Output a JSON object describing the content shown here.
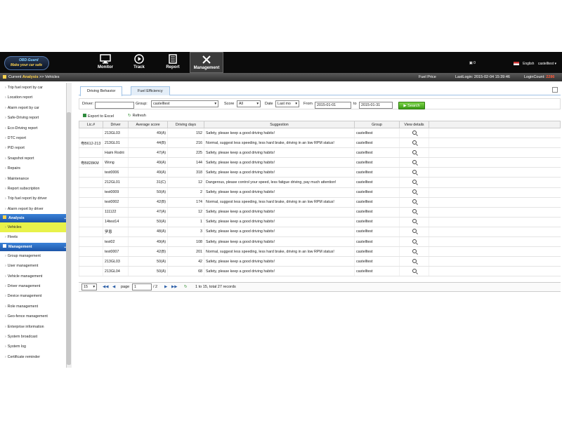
{
  "app": {
    "logo_top": "OBD-Guard",
    "logo_bottom": "Make your car safe"
  },
  "nav": [
    {
      "label": "Monitor",
      "icon": "monitor-icon"
    },
    {
      "label": "Track",
      "icon": "play-icon"
    },
    {
      "label": "Report",
      "icon": "report-icon"
    },
    {
      "label": "Management",
      "icon": "tools-icon"
    }
  ],
  "topright": {
    "camera_count": "0",
    "language": "English",
    "user": "castelltest"
  },
  "subbar": {
    "breadcrumb_prefix": "Current",
    "breadcrumb_section": "Analysis",
    "breadcrumb_sep": ">>",
    "breadcrumb_page": "Vehicles",
    "fuel_price": "Fuel Price",
    "last_login_label": "LastLogin:",
    "last_login_value": "2015-02-04 15:39:46",
    "login_count_label": "LoginCount:",
    "login_count_value": "2286"
  },
  "sidebar": {
    "report_items": [
      "Trip fuel report by car",
      "Location report",
      "Alarm report by car",
      "Safe-Driving report",
      "Eco-Driving report",
      "DTC report",
      "PID report",
      "Snapshot report",
      "Repairs",
      "Maintenance",
      "Report subscription",
      "Trip fuel report by driver",
      "Alarm report by driver"
    ],
    "analysis_head": "Analysis",
    "analysis_items": [
      "Vehicles",
      "Fleets"
    ],
    "management_head": "Management",
    "management_items": [
      "Group management",
      "User management",
      "Vehicle management",
      "Driver management",
      "Device management",
      "Role management",
      "Geo-fence management",
      "Enterprise information",
      "System broadcast",
      "System log",
      "Certificate reminder"
    ]
  },
  "tabs": [
    "Driving Behavior",
    "Fuel Efficiency"
  ],
  "filters": {
    "driver_label": "Driver:",
    "driver_value": "",
    "group_label": "Group:",
    "group_value": "castelltest",
    "score_label": "Score",
    "score_value": "All",
    "date_label": "Date",
    "date_value": "Last mo",
    "from_label": "From",
    "from_value": "2015-01-01",
    "to_label": "to",
    "to_value": "2015-01-31",
    "search_label": "Search"
  },
  "tools": {
    "export_label": "Export to Excel",
    "refresh_label": "Refresh"
  },
  "table": {
    "headers": [
      "Lic.#",
      "Driver",
      "Average score",
      "Driving days",
      "Suggestion",
      "Group",
      "View details"
    ],
    "rows": [
      [
        "",
        "213GL03",
        "49(A)",
        "152",
        "Safety, please keep a good driving habits!",
        "castelltest"
      ],
      [
        "粤B612-213",
        "213GL01",
        "44(B)",
        "216",
        "Normal, suggest less speeding, less hard brake, driving in an low RPM status!",
        "castelltest"
      ],
      [
        "",
        "Haim Rodrii",
        "47(A)",
        "225",
        "Safety, please keep a good driving habits!",
        "castelltest"
      ],
      [
        "粤B828KM",
        "Wong",
        "49(A)",
        "144",
        "Safety, please keep a good driving habits!",
        "castelltest"
      ],
      [
        "",
        "test0006",
        "49(A)",
        "318",
        "Safety, please keep a good driving habits!",
        "castelltest"
      ],
      [
        "",
        "212GL01",
        "31(C)",
        "12",
        "Dangerous, please control your speed, less fatigue driving, pay much attention!",
        "castelltest"
      ],
      [
        "",
        "test0009",
        "50(A)",
        "2",
        "Safety, please keep a good driving habits!",
        "castelltest"
      ],
      [
        "",
        "test0002",
        "42(B)",
        "174",
        "Normal, suggest less speeding, less hard brake, driving in an low RPM status!",
        "castelltest"
      ],
      [
        "",
        "111122",
        "47(A)",
        "12",
        "Safety, please keep a good driving habits!",
        "castelltest"
      ],
      [
        "",
        "14test14",
        "50(A)",
        "1",
        "Safety, please keep a good driving habits!",
        "castelltest"
      ],
      [
        "",
        "罗恩",
        "48(A)",
        "3",
        "Safety, please keep a good driving habits!",
        "castelltest"
      ],
      [
        "",
        "test02",
        "49(A)",
        "108",
        "Safety, please keep a good driving habits!",
        "castelltest"
      ],
      [
        "",
        "test0007",
        "42(B)",
        "201",
        "Normal, suggest less speeding, less hard brake, driving in an low RPM status!",
        "castelltest"
      ],
      [
        "",
        "213GL03",
        "50(A)",
        "42",
        "Safety, please keep a good driving habits!",
        "castelltest"
      ],
      [
        "",
        "213GL04",
        "50(A)",
        "68",
        "Safety, please keep a good driving habits!",
        "castelltest"
      ]
    ]
  },
  "pager": {
    "page_size": "15",
    "page_label": "page",
    "page_value": "1",
    "page_total": "/ 2",
    "summary": "1 to 15, total 27 records"
  }
}
